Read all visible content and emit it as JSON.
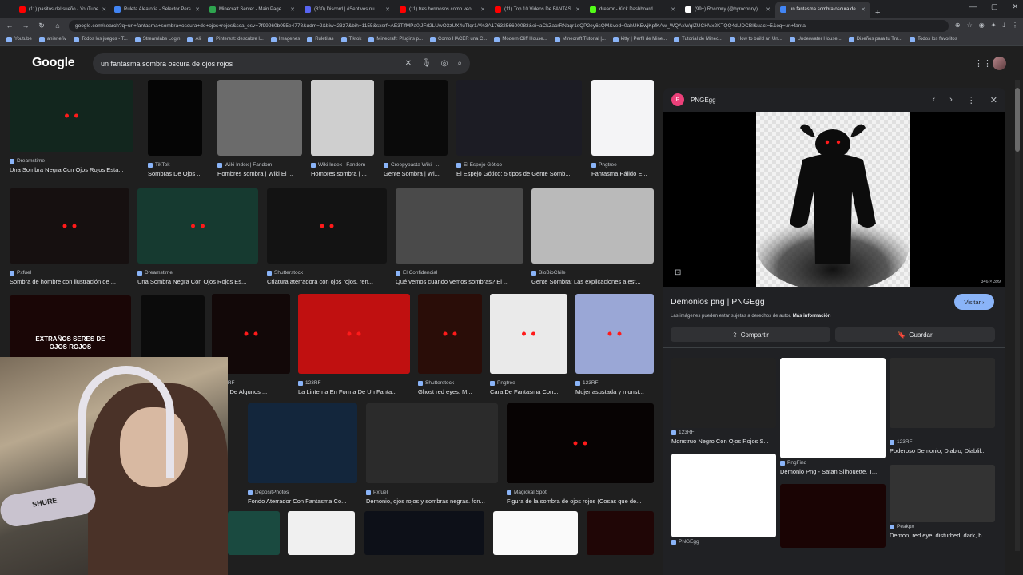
{
  "browser": {
    "tabs": [
      {
        "label": "(11) pasitos del sueño - YouTube",
        "color": "#ff0000"
      },
      {
        "label": "Ruleta Aleatoria - Selector Pers",
        "color": "#4285f4"
      },
      {
        "label": "Minecraft Server - Main Page",
        "color": "#2ea44f"
      },
      {
        "label": "(830) Discord | #Sentivos nu",
        "color": "#5865f2"
      },
      {
        "label": "(11) tres hermosos como veo",
        "color": "#ff0000"
      },
      {
        "label": "(11) Top 10 Videos De FANTAS",
        "color": "#ff0000"
      },
      {
        "label": "dreamr - Kick Dashboard",
        "color": "#53fc18"
      },
      {
        "label": "(99+) Roconny (@byroconny)",
        "color": "#ffffff"
      },
      {
        "label": "un fantasma sombra oscura de",
        "color": "#4285f4",
        "active": true
      }
    ],
    "url": "google.com/search?q=un+fantasma+sombra+oscura+de+ojos+rojos&sca_esv=7f99260b055e4778&udm=2&biw=2327&bih=1155&sxsrf=AE3TifMPa0jJFrl2LUwO3zUX4uTlqr1A%3A1763256600083&ei=aCkZacrRNaqr1sQP2ey6sQM&ved=0ahUKEwjKpfKAw_WQAxWqlZUCHVx2KTQQ4dUDCBI&uact=5&oq=un+fanta",
    "bookmarks": [
      "Youtube",
      "anienefiv",
      "Todos los juegos - T...",
      "Streamlabs Login",
      "Ali",
      "Pinterest: descubre l...",
      "Imagenes",
      "Ruletitas",
      "Tiktok",
      "Minecraft: Plugins p...",
      "Como HACER una C...",
      "Modern Cliff House...",
      "Minecraft Tutorial |...",
      "kitty | Perfil de Mine...",
      "Tutorial de Minec...",
      "How to build an Un...",
      "Underwater House...",
      "Diseños para tu Tra...",
      "Todos los favoritos"
    ]
  },
  "google": {
    "logo": "Google",
    "query": "un fantasma sombra oscura de ojos rojos"
  },
  "results": [
    {
      "src": "Dreamstime",
      "cap": "Una Sombra Negra Con Ojos Rojos Esta..."
    },
    {
      "src": "TikTok",
      "cap": "Sombras De Ojos ..."
    },
    {
      "src": "Wiki Index | Fandom",
      "cap": "Hombres sombra | Wiki El ..."
    },
    {
      "src": "Wiki Index | Fandom",
      "cap": "Hombres sombra | ..."
    },
    {
      "src": "Creepypasta Wiki - ...",
      "cap": "Gente Sombra | Wi..."
    },
    {
      "src": "El Espejo Gótico",
      "cap": "El Espejo Gótico: 5 tipos de Gente Somb..."
    },
    {
      "src": "Pngtree",
      "cap": "Fantasma Pálido E..."
    },
    {
      "src": "Pxfuel",
      "cap": "Sombra de hombre con ilustración de ..."
    },
    {
      "src": "Dreamstime",
      "cap": "Una Sombra Negra Con Ojos Rojos Es..."
    },
    {
      "src": "Shutterstock",
      "cap": "Criatura aterradora con ojos rojos, ren..."
    },
    {
      "src": "El Confidencial",
      "cap": "Qué vemos cuando vemos sombras? El ..."
    },
    {
      "src": "BioBioChile",
      "cap": "Gente Sombra: Las explicaciones a est..."
    },
    {
      "src": "123RF",
      "cap": "ración De Algunos ..."
    },
    {
      "src": "123RF",
      "cap": "La Linterna En Forma De Un Fanta..."
    },
    {
      "src": "Shutterstock",
      "cap": "Ghost red eyes: M..."
    },
    {
      "src": "Pngtree",
      "cap": "Cara De Fantasma Con..."
    },
    {
      "src": "123RF",
      "cap": "Mujer asustada y monst..."
    },
    {
      "src": "DepositPhotos",
      "cap": "Fondo Aterrador Con Fantasma Co..."
    },
    {
      "src": "Pxfuel",
      "cap": "Demonio, ojos rojos y sombras negras. fon..."
    },
    {
      "src": "Magickal Spot",
      "cap": "Figura de la sombra de ojos rojos (Cosas que de..."
    }
  ],
  "overlay_text": "EXTRAÑOS SERES DE OJOS ROJOS",
  "panel": {
    "site": "PNGEgg",
    "dims": "346 × 399",
    "title": "Demonios png | PNGEgg",
    "visit": "Visitar",
    "note": "Las imágenes pueden estar sujetas a derechos de autor.",
    "more": "Más información",
    "share": "Compartir",
    "save": "Guardar",
    "related": [
      {
        "src": "123RF",
        "cap": "Monstruo Negro Con Ojos Rojos S..."
      },
      {
        "src": "PngFind",
        "cap": "Demonio Png - Satan Silhouette, T..."
      },
      {
        "src": "123RF",
        "cap": "Poderoso Demonio, Diablo, Diablil..."
      },
      {
        "src": "PNGEgg",
        "cap": ""
      },
      {
        "src": "Peakpx",
        "cap": "Demon, red eye, disturbed, dark, b..."
      }
    ]
  },
  "webcam": {
    "mic_label": "SHURE"
  },
  "colors": {
    "accent": "#8ab4f8",
    "bg": "#1f1f1f",
    "panel": "#202124",
    "red_eye": "#ff1a1a"
  }
}
